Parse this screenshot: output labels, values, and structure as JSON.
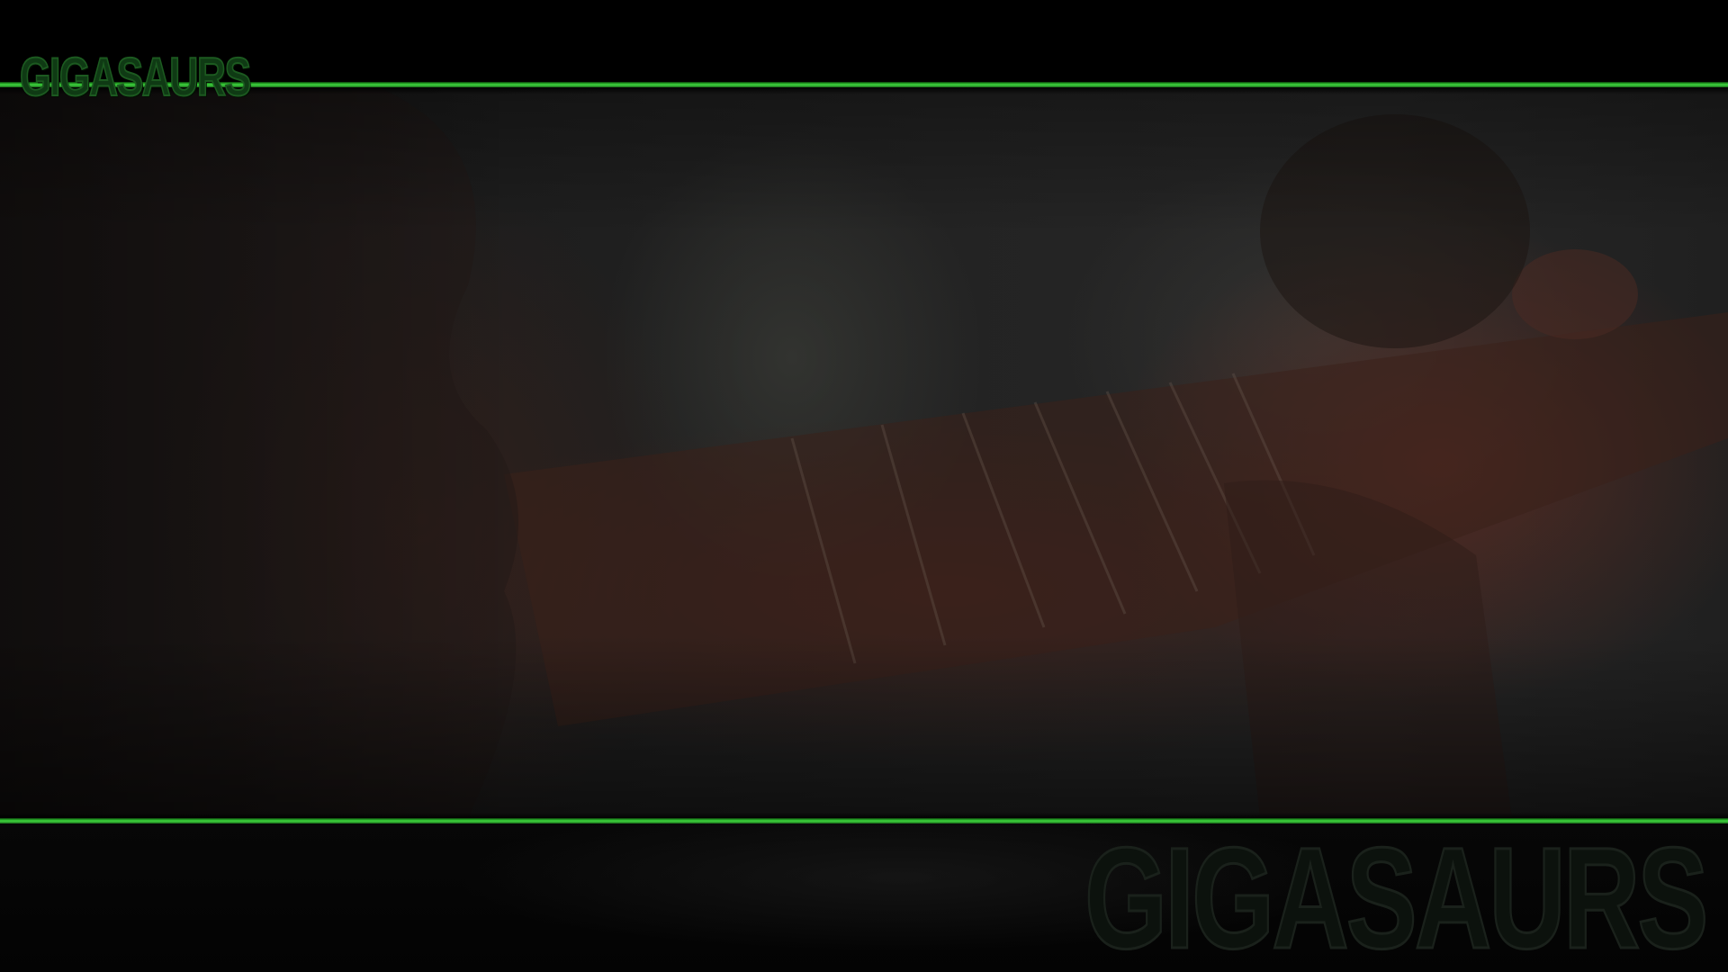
{
  "brand": {
    "logo_text": "GIGASAURS",
    "watermark_text": "GIGASAURS"
  },
  "colors": {
    "accent_green": "#2bb52b",
    "background": "#000000",
    "logo_fill": "#0f3a14"
  },
  "scene": {
    "image_subject": "band-photo-guitar"
  }
}
